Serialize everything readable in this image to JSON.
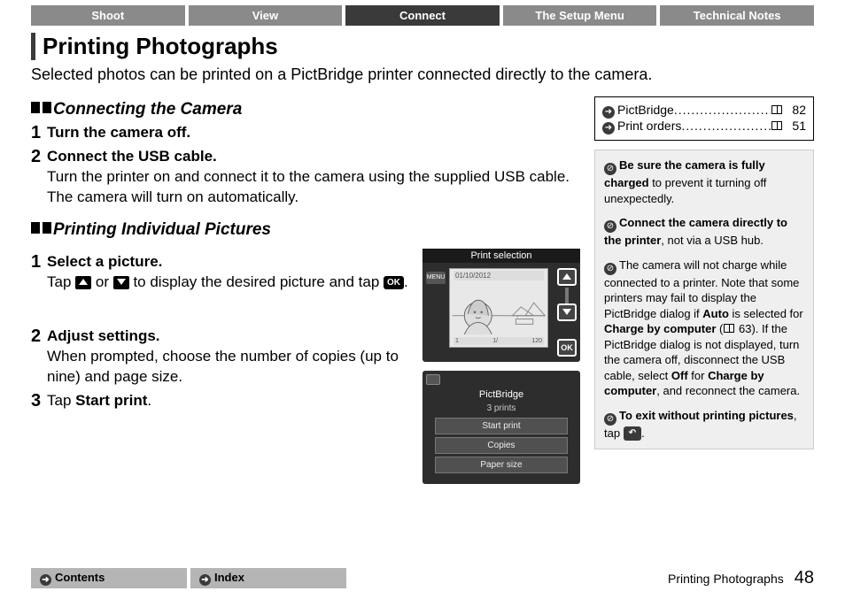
{
  "tabs": [
    "Shoot",
    "View",
    "Connect",
    "The Setup Menu",
    "Technical Notes"
  ],
  "active_tab": 2,
  "title": "Printing Photographs",
  "intro": "Selected photos can be printed on a PictBridge printer connected directly to the camera.",
  "sectionA": {
    "heading": "Connecting the Camera",
    "steps": [
      {
        "num": "1",
        "label": "Turn the camera off.",
        "text": ""
      },
      {
        "num": "2",
        "label": "Connect the USB cable.",
        "text": "Turn the printer on and connect it to the camera using the supplied USB cable. The camera will turn on automatically."
      }
    ]
  },
  "sectionB": {
    "heading": "Printing Individual Pictures",
    "steps": [
      {
        "num": "1",
        "label": "Select a picture.",
        "pre": "Tap ",
        "mid": " or ",
        "post": " to display the desired picture and tap ",
        "end": "."
      },
      {
        "num": "2",
        "label": "Adjust settings.",
        "text": "When prompted, choose the number of copies (up to nine) and page size."
      },
      {
        "num": "3",
        "label_pre": "Tap ",
        "label_bold": "Start print",
        "label_post": "."
      }
    ]
  },
  "screen1": {
    "title": "Print selection",
    "menu": "MENU",
    "date": "01/10/2012",
    "ok": "OK",
    "stat_left": "1",
    "stat_mid": "1/",
    "stat_right": "120"
  },
  "screen2": {
    "title": "PictBridge",
    "sub": "3 prints",
    "opts": [
      "Start print",
      "Copies",
      "Paper size"
    ]
  },
  "refs": [
    {
      "label": "PictBridge",
      "page": "82"
    },
    {
      "label": "Print orders",
      "page": "51"
    }
  ],
  "tips": {
    "t1a": "Be sure the camera is fully charged",
    "t1b": " to prevent it turning off unexpectedly.",
    "t2a": "Connect the camera directly to the printer",
    "t2b": ", not via a USB hub.",
    "t3a": "The camera will not charge while connected to a printer. Note that some printers may fail to display the PictBridge dialog if ",
    "t3_auto": "Auto",
    "t3b": " is selected for ",
    "t3_cbc": "Charge by computer",
    "t3c": " (",
    "t3_pg": "63",
    "t3d": "). If the PictBridge dialog is not displayed, turn the camera off, disconnect the USB cable, select ",
    "t3_off": "Off",
    "t3e": " for ",
    "t3_cbc2": "Charge by computer",
    "t3f": ", and reconnect the camera.",
    "t4a": "To exit without printing pictures",
    "t4b": ", tap ",
    "t4c": "."
  },
  "footer": {
    "contents": "Contents",
    "index": "Index",
    "section": "Printing Photographs",
    "page": "48"
  }
}
